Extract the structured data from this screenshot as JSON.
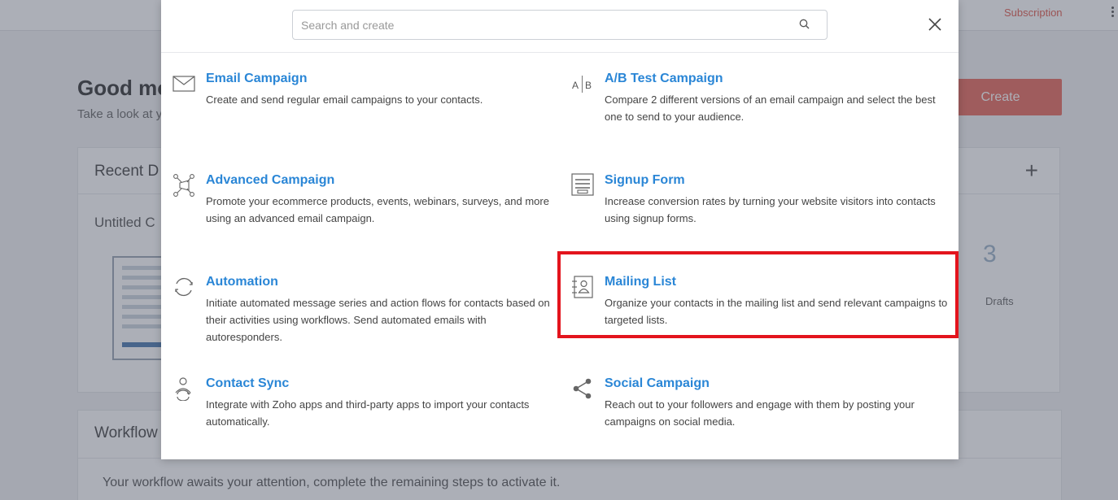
{
  "background": {
    "subscription_label": "Subscription",
    "greeting": "Good mo",
    "greeting_sub": "Take a look at y",
    "create_label": "Create",
    "recent_title": "Recent D",
    "plus_label": "+",
    "untitled_label": "Untitled C",
    "drafts_count": "3",
    "drafts_label": "Drafts",
    "workflow_title": "Workflow",
    "workflow_message": "Your workflow awaits your attention, complete the remaining steps to activate it."
  },
  "modal": {
    "search_placeholder": "Search and create",
    "items": [
      {
        "title": "Email Campaign",
        "icon": "envelope-icon",
        "description": "Create and send regular email campaigns to your contacts."
      },
      {
        "title": "A/B Test Campaign",
        "icon": "ab-test-icon",
        "description": "Compare 2 different versions of an email campaign and select the best one to send to your audience."
      },
      {
        "title": "Advanced Campaign",
        "icon": "advanced-campaign-icon",
        "description": "Promote your ecommerce products, events, webinars, surveys, and more using an advanced email campaign."
      },
      {
        "title": "Signup Form",
        "icon": "signup-form-icon",
        "description": "Increase conversion rates by turning your website visitors into contacts using signup forms."
      },
      {
        "title": "Automation",
        "icon": "refresh-icon",
        "description": "Initiate automated message series and action flows for contacts based on their activities using workflows. Send automated emails with autoresponders."
      },
      {
        "title": "Mailing List",
        "icon": "contact-book-icon",
        "description": "Organize your contacts in the mailing list and send relevant campaigns to targeted lists."
      },
      {
        "title": "Contact Sync",
        "icon": "contact-sync-icon",
        "description": "Integrate with Zoho apps and third-party apps to import your contacts automatically."
      },
      {
        "title": "Social Campaign",
        "icon": "share-icon",
        "description": "Reach out to your followers and engage with them by posting your campaigns on social media."
      }
    ]
  },
  "colors": {
    "link_blue": "#2a86d6",
    "highlight_red": "#e3141d",
    "create_button": "#e8685c"
  }
}
